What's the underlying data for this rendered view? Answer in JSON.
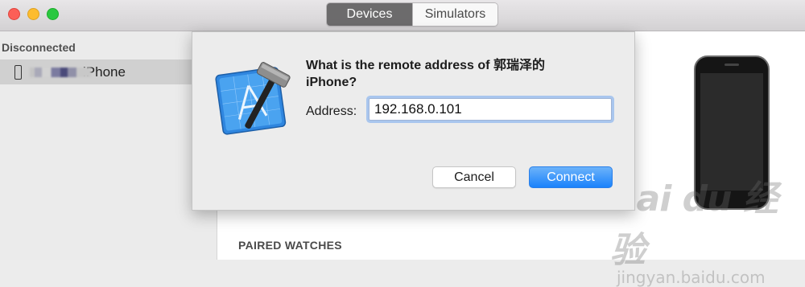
{
  "window": {
    "tabs": [
      {
        "label": "Devices",
        "active": true
      },
      {
        "label": "Simulators",
        "active": false
      }
    ]
  },
  "sidebar": {
    "section_header": "Disconnected",
    "device": {
      "name": "iPhone",
      "icon": "iphone-icon"
    }
  },
  "main": {
    "paired_watches_header": "PAIRED WATCHES"
  },
  "dialog": {
    "prompt": "What is the remote address of 郭瑞泽的iPhone?",
    "address_label": "Address:",
    "address_value": "192.168.0.101",
    "cancel_label": "Cancel",
    "connect_label": "Connect",
    "icon": "xcode-app-icon"
  },
  "watermark": {
    "logo": "Bai du 经验",
    "url": "jingyan.baidu.com"
  },
  "colors": {
    "accent": "#1a82fb",
    "focus_ring": "#a9c6ee"
  }
}
